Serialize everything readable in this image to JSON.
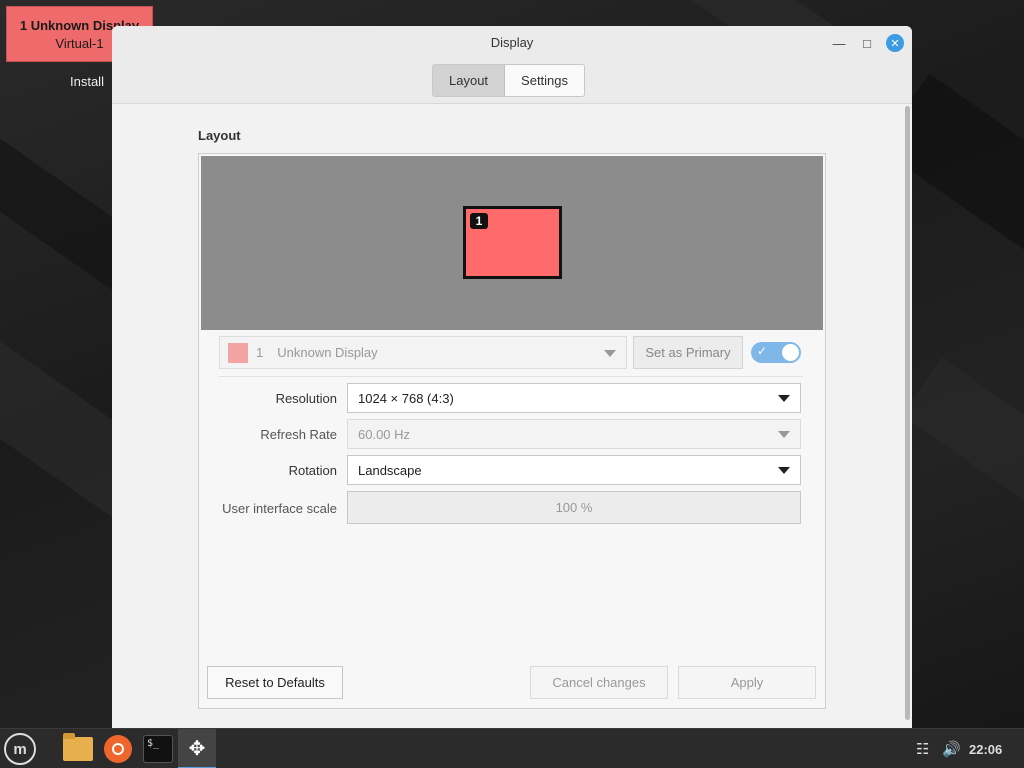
{
  "desktop": {
    "identify_popup": {
      "line1": "1  Unknown Display",
      "line2": "Virtual-1"
    },
    "install_label": "Install"
  },
  "window": {
    "title": "Display",
    "tabs": [
      {
        "label": "Layout",
        "active": true
      },
      {
        "label": "Settings",
        "active": false
      }
    ]
  },
  "layout": {
    "section_title": "Layout",
    "monitor_number": "1",
    "monitor_color": "#ff6b6b",
    "display_select": {
      "number": "1",
      "name": "Unknown Display"
    },
    "set_primary_label": "Set as Primary",
    "enabled_toggle": true
  },
  "settings": {
    "resolution_label": "Resolution",
    "resolution_value": "1024 × 768 (4:3)",
    "refresh_label": "Refresh Rate",
    "refresh_value": "60.00 Hz",
    "rotation_label": "Rotation",
    "rotation_value": "Landscape",
    "scale_label": "User interface scale",
    "scale_value": "100 %"
  },
  "actions": {
    "reset_label": "Reset to Defaults",
    "cancel_label": "Cancel changes",
    "apply_label": "Apply"
  },
  "taskbar": {
    "clock": "22:06",
    "terminal_prompt": "$_"
  },
  "colors": {
    "accent": "#3d9be3",
    "monitor": "#ff6b6b",
    "toggle": "#7fb8e8"
  }
}
